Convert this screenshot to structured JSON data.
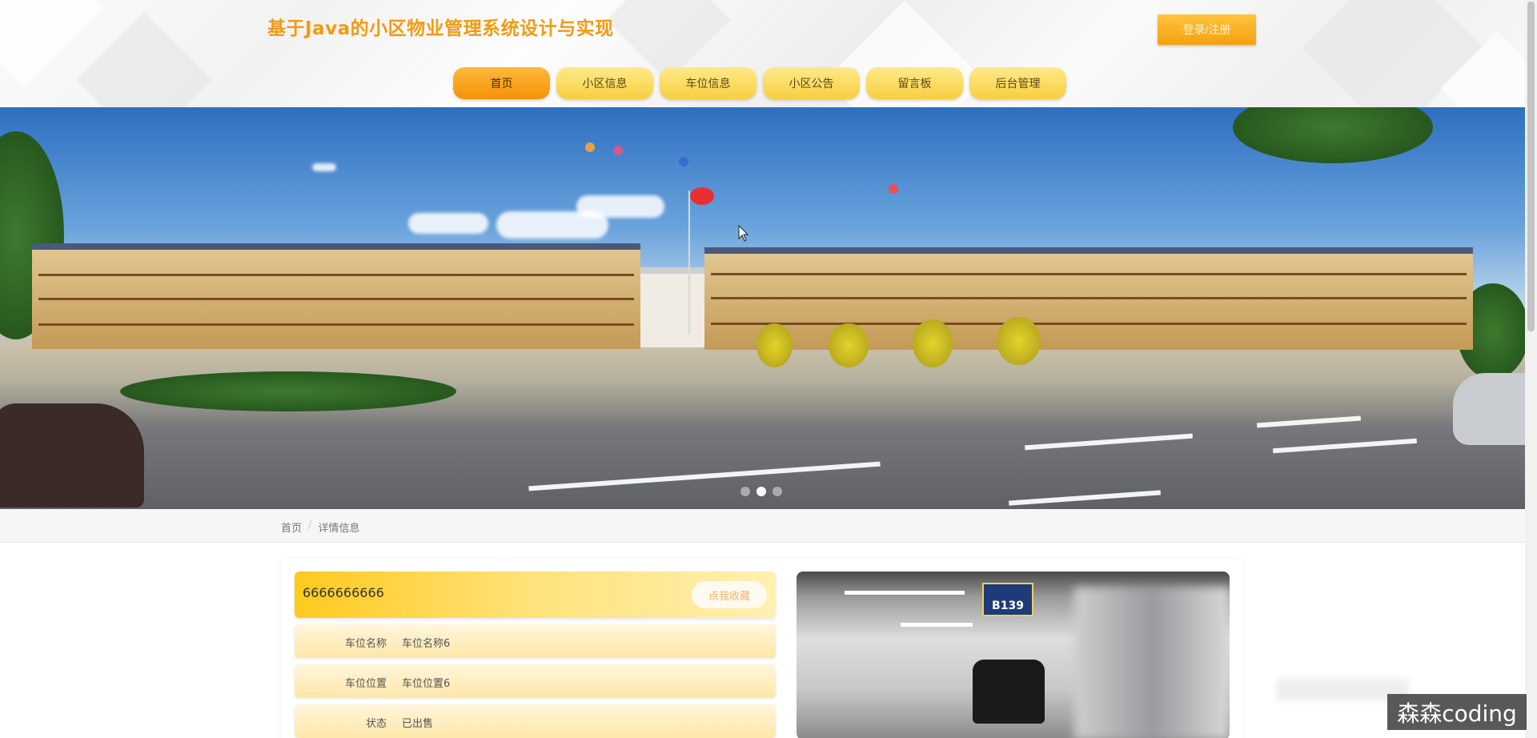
{
  "header": {
    "site_title": "基于Java的小区物业管理系统设计与实现",
    "login_label": "登录/注册"
  },
  "nav": {
    "items": [
      {
        "label": "首页",
        "active": true
      },
      {
        "label": "小区信息",
        "active": false
      },
      {
        "label": "车位信息",
        "active": false
      },
      {
        "label": "小区公告",
        "active": false
      },
      {
        "label": "留言板",
        "active": false
      },
      {
        "label": "后台管理",
        "active": false
      }
    ]
  },
  "carousel": {
    "slide_count": 3,
    "active_index": 1
  },
  "breadcrumb": {
    "home": "首页",
    "current": "详情信息"
  },
  "detail": {
    "title": "6666666666",
    "favorite_label": "点我收藏",
    "fields": [
      {
        "label": "车位名称",
        "value": "车位名称6"
      },
      {
        "label": "车位位置",
        "value": "车位位置6"
      },
      {
        "label": "状态",
        "value": "已出售"
      }
    ],
    "image_sign": "B139"
  },
  "watermark": "森森coding",
  "colors": {
    "accent": "#f5a011",
    "title": "#f39a10",
    "nav": "#f7cf3e"
  }
}
